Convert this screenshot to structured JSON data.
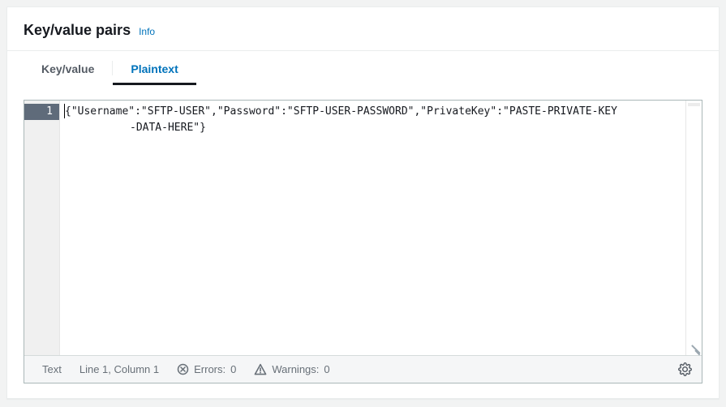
{
  "header": {
    "title": "Key/value pairs",
    "info_label": "Info"
  },
  "tabs": {
    "key_value": "Key/value",
    "plaintext": "Plaintext",
    "active": "plaintext"
  },
  "editor": {
    "line_numbers": [
      "1"
    ],
    "content": "{\"Username\":\"SFTP-USER\",\"Password\":\"SFTP-USER-PASSWORD\",\"PrivateKey\":\"PASTE-PRIVATE-KEY-DATA-HERE\"}",
    "wrap_tail": "-DATA-HERE\"}"
  },
  "status": {
    "mode": "Text",
    "cursor": "Line 1, Column 1",
    "errors_label": "Errors:",
    "errors_count": "0",
    "warnings_label": "Warnings:",
    "warnings_count": "0"
  },
  "icons": {
    "gear": "settings"
  }
}
